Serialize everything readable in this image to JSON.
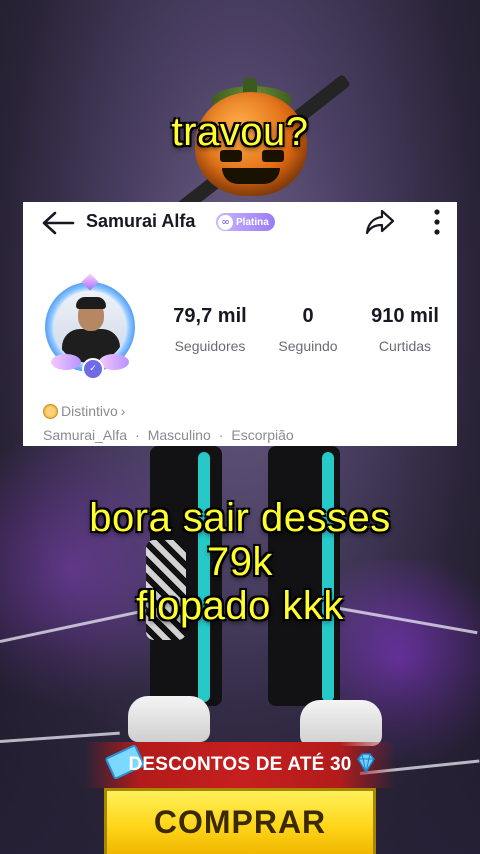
{
  "overlay_text": {
    "top": "travou?",
    "bottom_line1": "bora sair desses",
    "bottom_line2": "79k",
    "bottom_line3": "flopado kkk"
  },
  "profile": {
    "username": "Samurai Alfa",
    "tier_badge": "Platina",
    "stats": [
      {
        "value": "79,7 mil",
        "label": "Seguidores"
      },
      {
        "value": "0",
        "label": "Seguindo"
      },
      {
        "value": "910 mil",
        "label": "Curtidas"
      }
    ],
    "distintivo_label": "Distintivo",
    "distintivo_chevron": "›",
    "info": {
      "handle": "Samurai_Alfa",
      "sep": "·",
      "gender": "Masculino",
      "sign": "Escorpião"
    }
  },
  "promo": {
    "ribbon_text": "DESCONTOS DE ATÉ 30",
    "button_label": "COMPRAR"
  },
  "icons": {
    "back": "back-arrow-icon",
    "share": "share-icon",
    "more": "more-vertical-icon",
    "platina": "platina-badge-icon",
    "distintivo": "distintivo-coin-icon",
    "ticket": "ticket-icon",
    "gem": "diamond-icon"
  },
  "colors": {
    "caption": "#ffff2e",
    "promo_red": "#c61f1f",
    "button_yellow": "#ffd61a",
    "card_bg": "#ffffff"
  }
}
